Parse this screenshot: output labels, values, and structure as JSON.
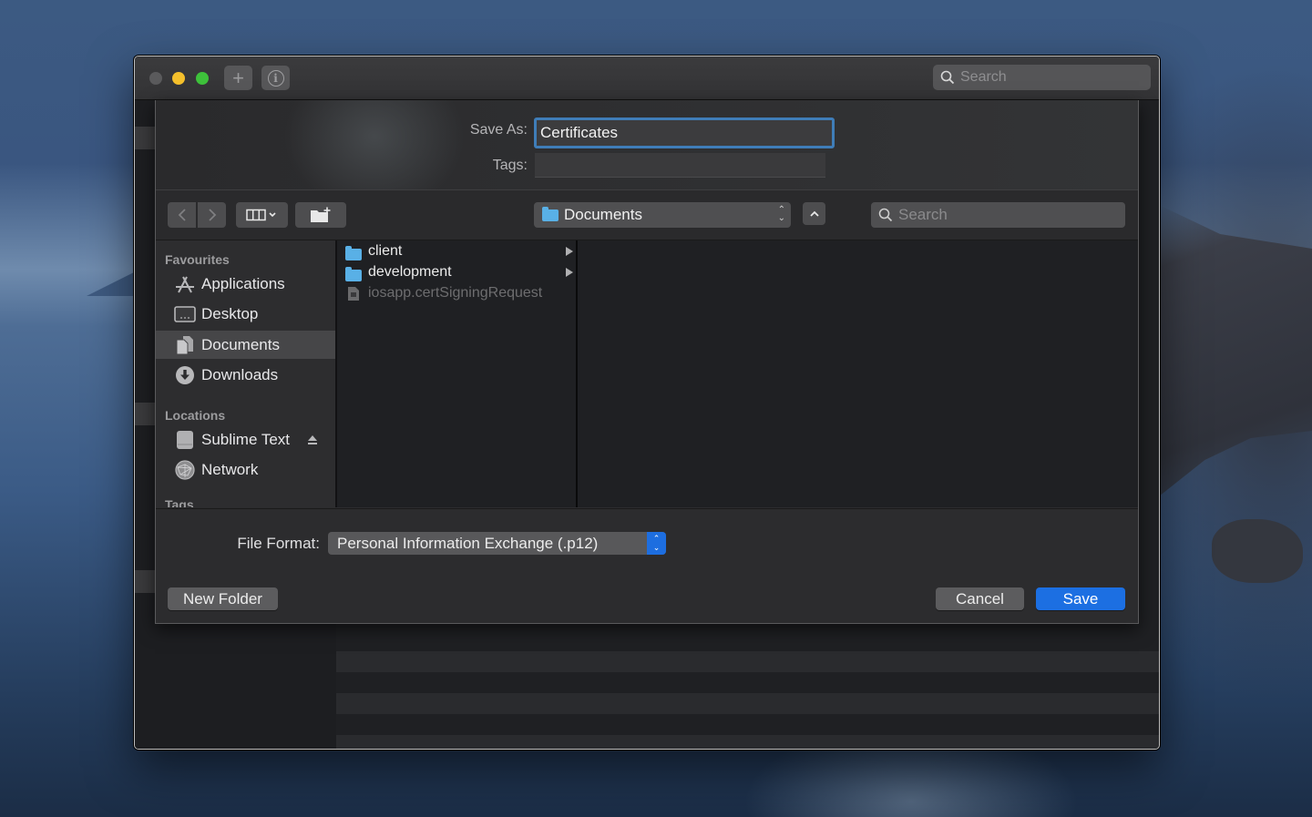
{
  "window": {
    "title_search_placeholder": "Search"
  },
  "dialog": {
    "save_as_label": "Save As:",
    "save_as_value": "Certificates",
    "tags_label": "Tags:",
    "tags_value": "",
    "location": "Documents",
    "search_placeholder": "Search",
    "sidebar": {
      "favourites_header": "Favourites",
      "favourites": [
        {
          "label": "Applications",
          "icon": "applications-icon"
        },
        {
          "label": "Desktop",
          "icon": "desktop-icon"
        },
        {
          "label": "Documents",
          "icon": "documents-icon",
          "selected": true
        },
        {
          "label": "Downloads",
          "icon": "downloads-icon"
        }
      ],
      "locations_header": "Locations",
      "locations": [
        {
          "label": "Sublime Text",
          "icon": "drive-icon",
          "ejectable": true
        },
        {
          "label": "Network",
          "icon": "network-icon"
        }
      ],
      "tags_header": "Tags"
    },
    "files": [
      {
        "name": "client",
        "type": "folder",
        "has_children": true
      },
      {
        "name": "development",
        "type": "folder",
        "has_children": true
      },
      {
        "name": "iosapp.certSigningRequest",
        "type": "file",
        "disabled": true
      }
    ],
    "file_format_label": "File Format:",
    "file_format_value": "Personal Information Exchange (.p12)",
    "new_folder_label": "New Folder",
    "cancel_label": "Cancel",
    "save_label": "Save"
  },
  "colors": {
    "accent": "#1c6fe2",
    "focus_ring": "#3f7db8",
    "folder": "#59b0e6"
  }
}
